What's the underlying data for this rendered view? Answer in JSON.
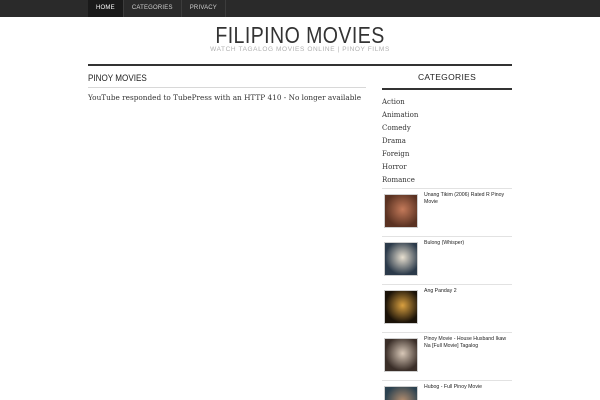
{
  "nav": {
    "items": [
      {
        "label": "HOME",
        "active": true
      },
      {
        "label": "CATEGORIES",
        "active": false
      },
      {
        "label": "PRIVACY",
        "active": false
      }
    ]
  },
  "header": {
    "title": "FILIPINO MOVIES",
    "tagline": "WATCH TAGALOG MOVIES ONLINE | PINOY FILMS"
  },
  "main": {
    "post_title": "PINOY MOVIES",
    "message": "YouTube responded to TubePress with an HTTP 410 - No longer available"
  },
  "sidebar": {
    "categories_title": "CATEGORIES",
    "categories": [
      "Action",
      "Animation",
      "Comedy",
      "Drama",
      "Foreign",
      "Horror",
      "Romance"
    ],
    "videos": [
      {
        "title": "Unang Tikim (2006) Rated R Pinoy Movie",
        "thumb_color": "#5a3222",
        "thumb_accent": "#c47a5a"
      },
      {
        "title": "Bulong (Whisper)",
        "thumb_color": "#2b3a4a",
        "thumb_accent": "#e8e0d0"
      },
      {
        "title": "Ang Panday 2",
        "thumb_color": "#1a1208",
        "thumb_accent": "#d9a040"
      },
      {
        "title": "Pinoy Movie - House Husband Ikaw Na [Full Movie] Tagalog",
        "thumb_color": "#3a2e28",
        "thumb_accent": "#d8c8b8"
      },
      {
        "title": "Hubog - Full Pinoy Movie",
        "thumb_color": "#2c4250",
        "thumb_accent": "#b89070"
      }
    ]
  }
}
